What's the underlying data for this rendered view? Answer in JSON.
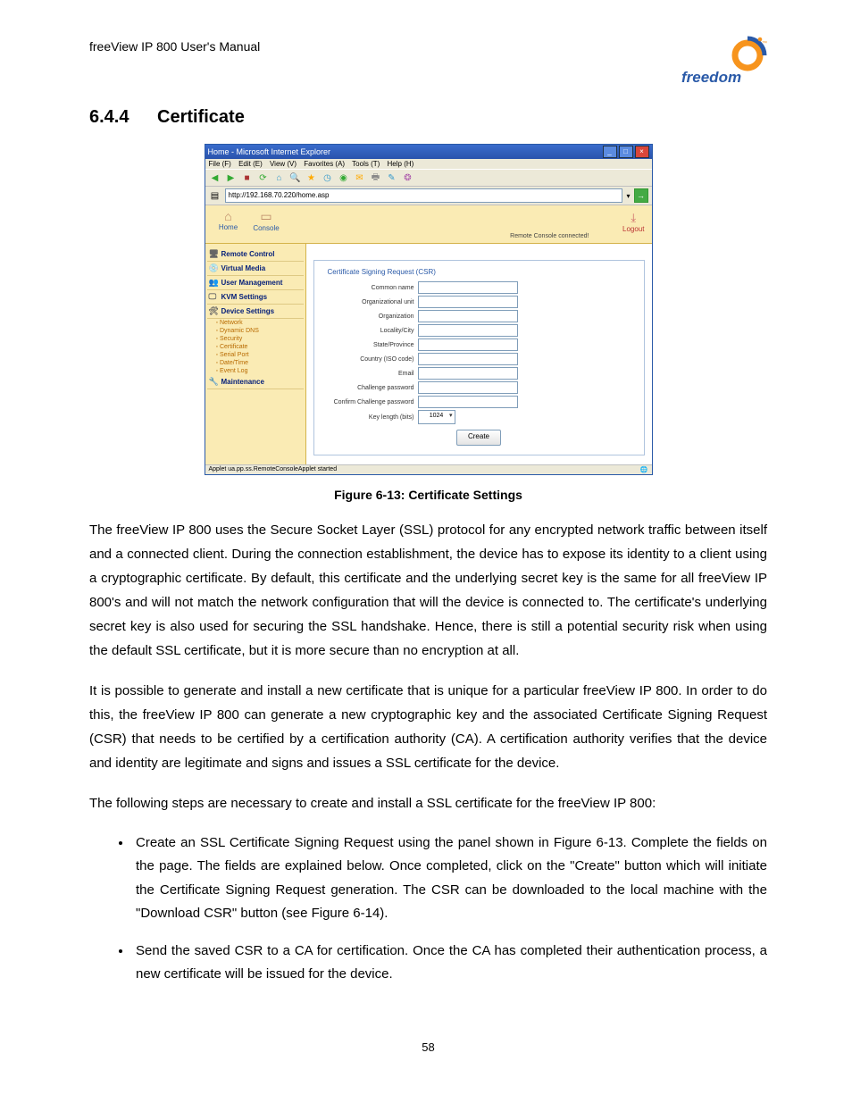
{
  "header": {
    "doc_title": "freeView IP 800 User's Manual"
  },
  "section": {
    "number": "6.4.4",
    "title": "Certificate"
  },
  "logo": {
    "text": "freedom",
    "tm": "™"
  },
  "screenshot": {
    "window_title": "Home - Microsoft Internet Explorer",
    "menus": {
      "file": "File (F)",
      "edit": "Edit (E)",
      "view": "View (V)",
      "favorites": "Favorites (A)",
      "tools": "Tools (T)",
      "help": "Help (H)"
    },
    "address_url": "http://192.168.70.220/home.asp",
    "top": {
      "home": "Home",
      "console": "Console",
      "logout": "Logout",
      "status": "Remote Console connected!"
    },
    "sidebar": {
      "items": [
        {
          "label": "Remote Control"
        },
        {
          "label": "Virtual Media"
        },
        {
          "label": "User Management"
        },
        {
          "label": "KVM Settings"
        },
        {
          "label": "Device Settings"
        }
      ],
      "subitems": [
        {
          "label": "Network"
        },
        {
          "label": "Dynamic DNS"
        },
        {
          "label": "Security"
        },
        {
          "label": "Certificate"
        },
        {
          "label": "Serial Port"
        },
        {
          "label": "Date/Time"
        },
        {
          "label": "Event Log"
        }
      ],
      "last": {
        "label": "Maintenance"
      }
    },
    "form": {
      "legend": "Certificate Signing Request (CSR)",
      "rows": [
        "Common name",
        "Organizational unit",
        "Organization",
        "Locality/City",
        "State/Province",
        "Country (ISO code)",
        "Email",
        "Challenge password",
        "Confirm Challenge password"
      ],
      "keylen_label": "Key length (bits)",
      "keylen_value": "1024",
      "create": "Create"
    },
    "statusbar": "Applet ua.pp.ss.RemoteConsoleApplet started"
  },
  "figure_caption": "Figure 6-13: Certificate Settings",
  "paragraphs": {
    "p1": "The freeView IP 800 uses the Secure Socket Layer (SSL) protocol for any encrypted network traffic between itself and a connected client. During the connection establishment, the device has to expose its identity to a client using a cryptographic certificate. By default, this certificate and the underlying secret key is the same for all freeView IP 800's and will not match the network configuration that will the device is connected to. The certificate's underlying secret key is also used for securing the SSL handshake. Hence, there is still a potential security risk when using the default SSL certificate, but it is more secure than no encryption at all.",
    "p2": "It is possible to generate and install a new certificate that is unique for a particular freeView IP 800. In order to do this, the freeView IP 800 can generate a new cryptographic key and the associated Certificate Signing Request (CSR) that needs to be certified by a certification authority (CA). A certification authority verifies that the device and identity are legitimate and signs and issues a SSL certificate for the device.",
    "p3": "The following steps are necessary to create and install a SSL certificate for the freeView IP 800:"
  },
  "bullets": {
    "b1": "Create an SSL Certificate Signing Request using the panel shown in Figure 6-13. Complete the fields on the page. The fields are explained below. Once completed, click on the \"Create\" button which will initiate the Certificate Signing Request generation. The CSR can be downloaded to the local machine with the \"Download CSR\" button (see Figure 6-14).",
    "b2": "Send the saved CSR to a CA for certification. Once the CA has completed their authentication process, a new certificate will be issued for the device."
  },
  "page_number": "58"
}
